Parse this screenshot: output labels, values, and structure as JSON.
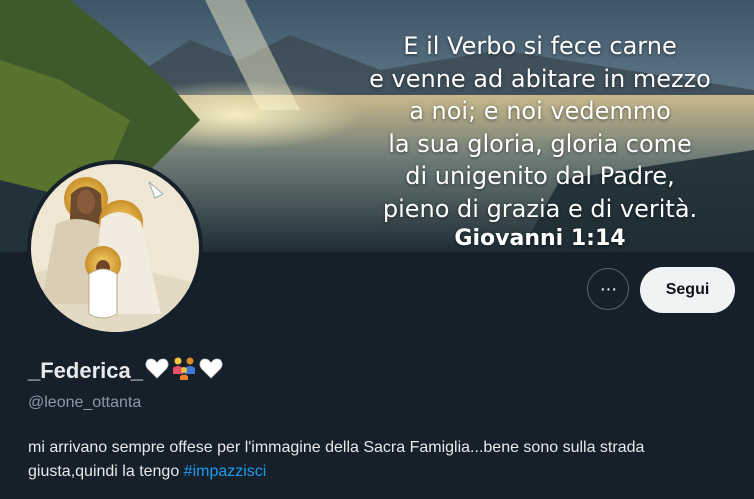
{
  "banner": {
    "verse_lines": [
      "E il Verbo si fece carne",
      "e venne ad abitare in mezzo",
      "a noi; e noi vedemmo",
      "la sua gloria, gloria come",
      "di unigenito dal Padre,",
      "pieno di grazia e di verità."
    ],
    "reference": "Giovanni 1:14"
  },
  "actions": {
    "more_label": "···",
    "follow_label": "Segui"
  },
  "profile": {
    "display_name": "_Federica_",
    "name_emojis": [
      "white-heart-icon",
      "family-icon",
      "white-heart-icon"
    ],
    "handle": "@leone_ottanta",
    "bio_text": "mi arrivano sempre offese per l'immagine della Sacra Famiglia...bene sono sulla strada giusta,quindi la tengo ",
    "bio_hashtag": "#impazzisci"
  },
  "colors": {
    "background": "#15202b",
    "accent": "#1d9bf0",
    "secondary_text": "#8b98a5"
  }
}
